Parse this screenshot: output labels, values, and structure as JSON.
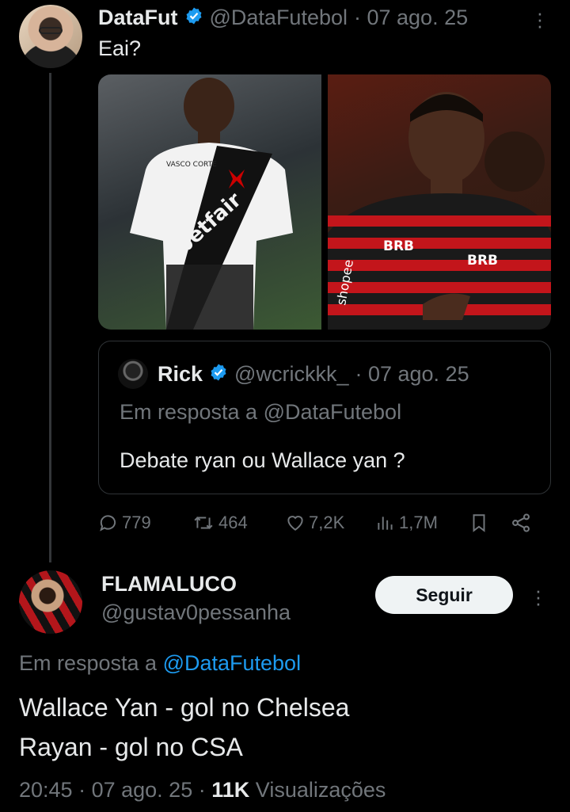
{
  "parent_post": {
    "author_name": "DataFut",
    "author_handle": "@DataFutebol",
    "date": "· 07 ago. 25",
    "text": "Eai?",
    "images": [
      {
        "alt": "Jogador do Vasco com camisa betfair",
        "sponsor": "betfair",
        "brand": "VASCO CORTE"
      },
      {
        "alt": "Jogador do Flamengo com camisa BRB",
        "sponsor": "BRB",
        "brand": "shopee"
      }
    ],
    "quote": {
      "author_name": "Rick",
      "author_handle": "@wcrickkk_",
      "date": "· 07 ago. 25",
      "reply_prefix": "Em resposta a @DataFutebol",
      "text": "Debate ryan ou Wallace yan ?"
    },
    "stats": {
      "replies": "779",
      "reposts": "464",
      "likes": "7,2K",
      "views": "1,7M"
    }
  },
  "reply_post": {
    "author_name": "FLAMALUCO",
    "author_handle": "@gustav0pessanha",
    "follow_label": "Seguir",
    "reply_prefix": "Em resposta a ",
    "reply_to": "@DataFutebol",
    "line1": "Wallace Yan - gol no Chelsea",
    "line2": "Rayan - gol no CSA",
    "time": "20:45",
    "date": "07 ago. 25",
    "view_count": "11K",
    "view_label": "Visualizações"
  },
  "colors": {
    "background": "#000000",
    "text": "#e7e9ea",
    "muted": "#71767b",
    "link": "#1d9bf0",
    "verified": "#1d9bf0",
    "border": "#2f3336"
  }
}
